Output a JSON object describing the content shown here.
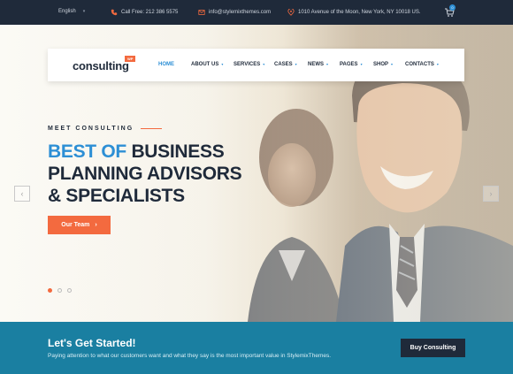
{
  "topbar": {
    "language": "English",
    "phone": "Call Free: 212 386 5575",
    "email": "info@stylemixthemes.com",
    "address": "1010 Avenue of the Moon, New York, NY 10018 US.",
    "cart_count": "0"
  },
  "logo": {
    "text": "consulting",
    "badge": "WP"
  },
  "nav": {
    "items": [
      {
        "label": "HOME"
      },
      {
        "label": "ABOUT US"
      },
      {
        "label": "SERVICES"
      },
      {
        "label": "CASES"
      },
      {
        "label": "NEWS"
      },
      {
        "label": "PAGES"
      },
      {
        "label": "SHOP"
      },
      {
        "label": "CONTACTS"
      }
    ]
  },
  "hero": {
    "kicker": "MEET CONSULTING",
    "headline_highlight": "BEST OF",
    "headline_rest_1": " BUSINESS",
    "headline_line_2": "PLANNING ADVISORS",
    "headline_line_3": "& SPECIALISTS",
    "cta_label": "Our Team",
    "arrow_left": "‹",
    "arrow_right": "›"
  },
  "band": {
    "title": "Let's Get Started!",
    "text": "Paying attention to what our customers want and what they say is the most important value in StylemixThemes.",
    "button": "Buy Consulting"
  },
  "colors": {
    "accent_blue": "#2d8fd5",
    "accent_orange": "#f36a3f",
    "navy": "#1f2a3a",
    "teal_band": "#1a7fa1"
  }
}
